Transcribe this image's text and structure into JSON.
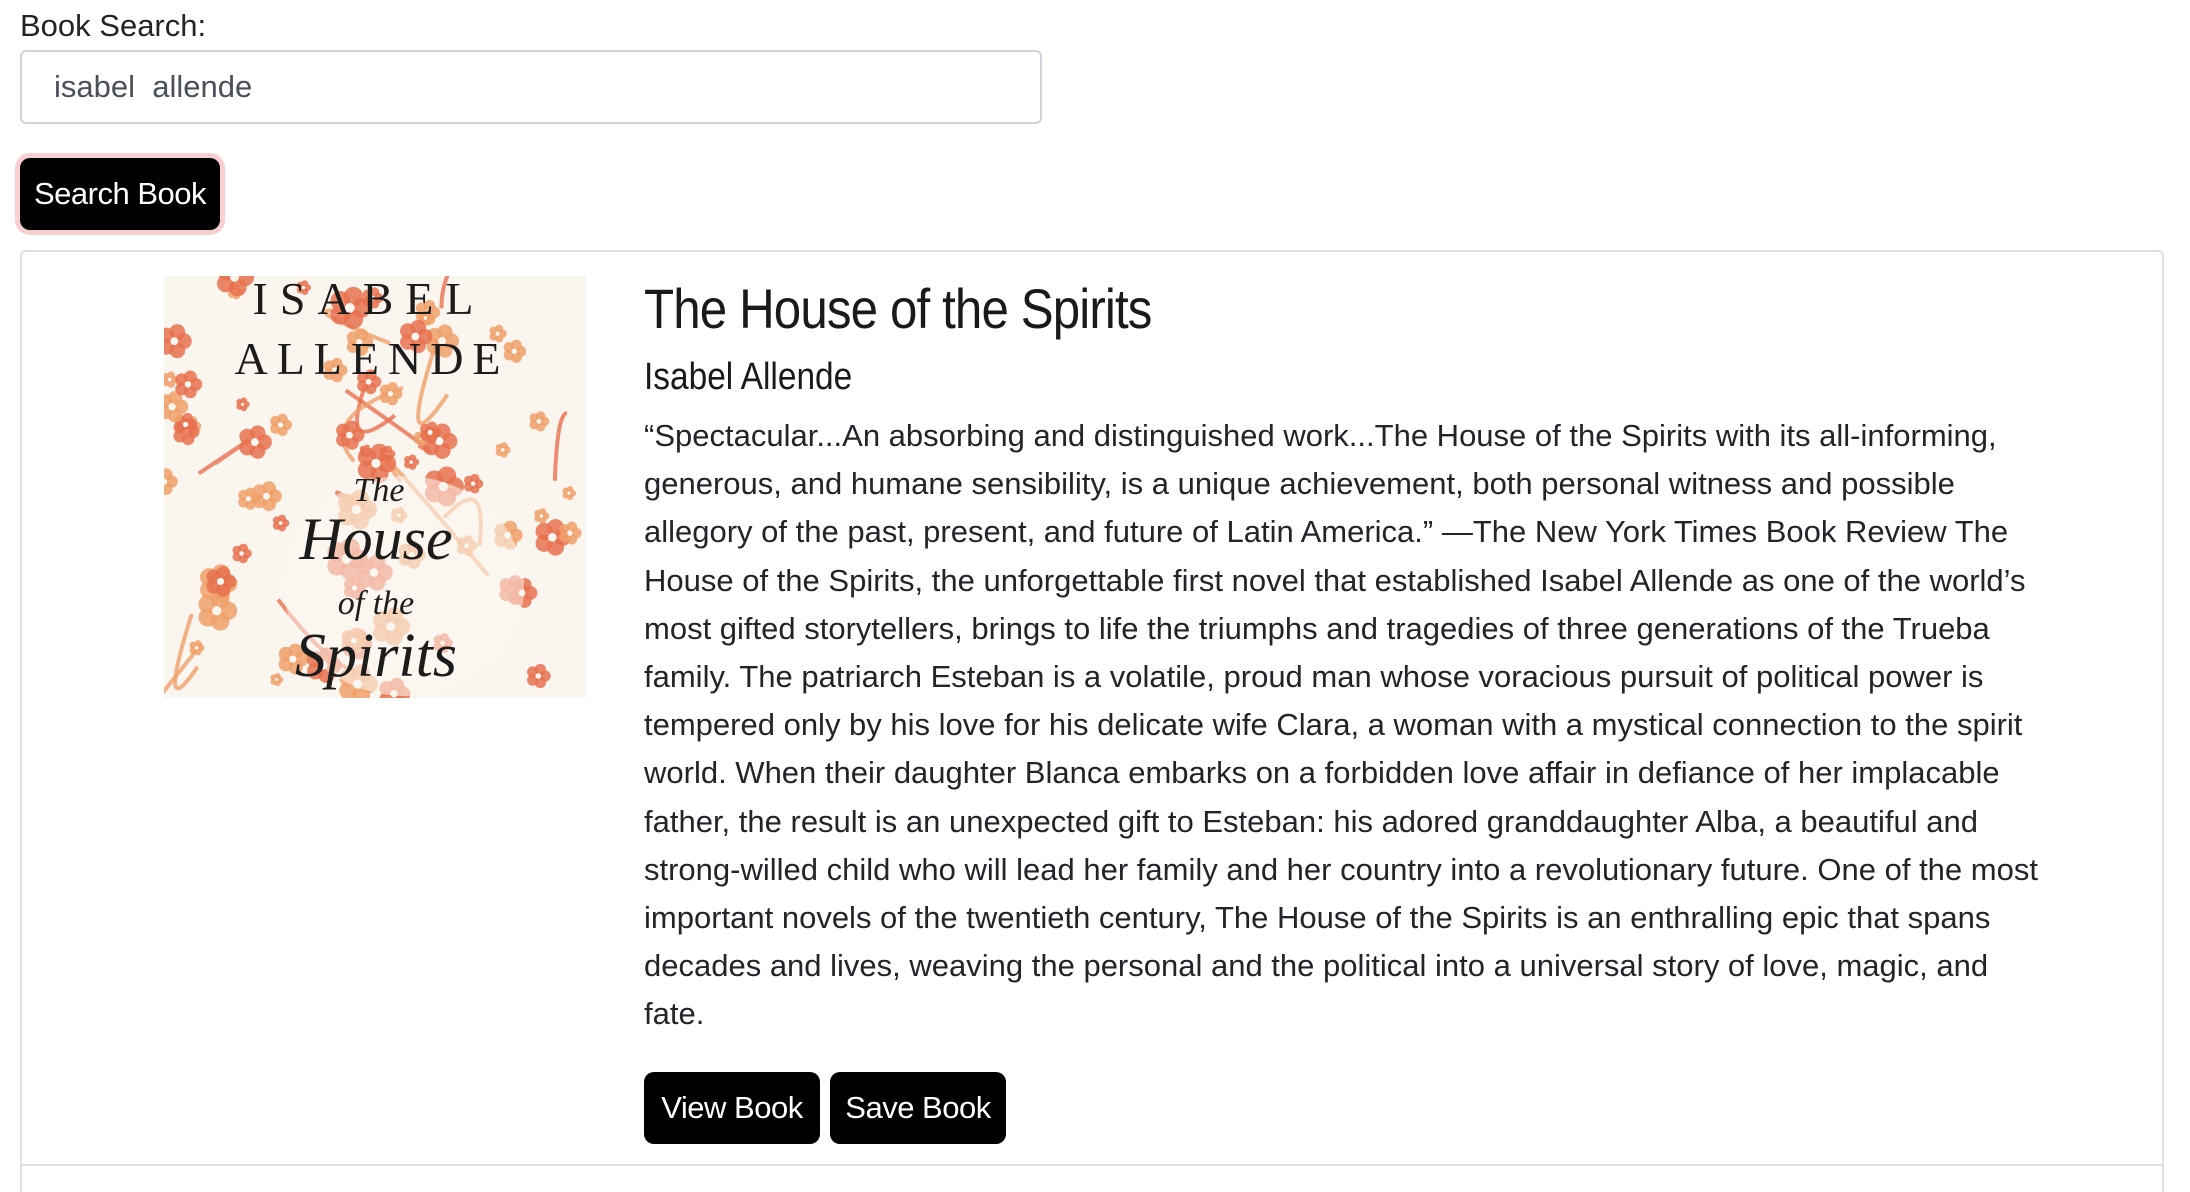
{
  "search": {
    "label": "Book Search:",
    "value": "isabel  allende",
    "button_label": "Search Book"
  },
  "result": {
    "cover": {
      "author_line_1": "ISABEL",
      "author_line_2": "ALLENDE",
      "title_line_1": "The",
      "title_line_2": "House",
      "title_line_3": "of the",
      "title_line_4": "Spirits",
      "colors": {
        "background": "#fbf5ef",
        "floral_primary": "#e8714f",
        "floral_secondary": "#f0a06a",
        "text": "#1c1c1c"
      }
    },
    "title": "The House of the Spirits",
    "author": "Isabel Allende",
    "description": "“Spectacular...An absorbing and distinguished work...The House of the Spirits with its all-informing, generous, and humane sensibility, is a unique achievement, both personal witness and possible allegory of the past, present, and future of Latin America.” —The New York Times Book Review The House of the Spirits, the unforgettable first novel that established Isabel Allende as one of the world’s most gifted storytellers, brings to life the triumphs and tragedies of three generations of the Trueba family. The patriarch Esteban is a volatile, proud man whose voracious pursuit of political power is tempered only by his love for his delicate wife Clara, a woman with a mystical connection to the spirit world. When their daughter Blanca embarks on a forbidden love affair in defiance of her implacable father, the result is an unexpected gift to Esteban: his adored granddaughter Alba, a beautiful and strong-willed child who will lead her family and her country into a revolutionary future. One of the most important novels of the twentieth century, The House of the Spirits is an enthralling epic that spans decades and lives, weaving the personal and the political into a universal story of love, magic, and fate.",
    "view_label": "View Book",
    "save_label": "Save Book"
  },
  "colors": {
    "button_bg": "#000000",
    "button_text": "#ffffff",
    "focus_ring": "#f8cfd1",
    "border": "#dfdfdf"
  }
}
